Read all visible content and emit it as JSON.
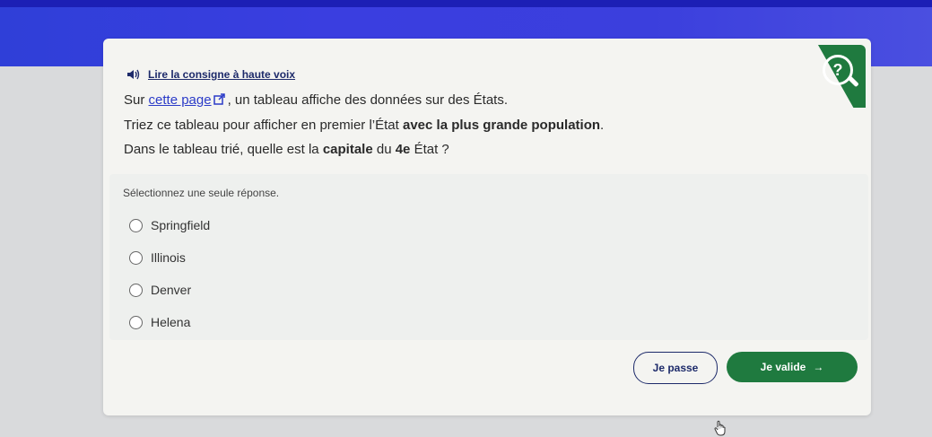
{
  "audio": {
    "label": "Lire la consigne à haute voix",
    "icon": "speaker-icon"
  },
  "question": {
    "line1": {
      "before": "Sur ",
      "link": "cette page",
      "after": ", un tableau affiche des données sur des États."
    },
    "line2": {
      "before": "Triez ce tableau pour afficher en premier l’État ",
      "bold": "avec la plus grande population",
      "after": "."
    },
    "line3": {
      "before": "Dans le tableau trié, quelle est la ",
      "bold1": "capitale",
      "mid": " du ",
      "bold2": "4e",
      "after": " État ?"
    }
  },
  "help_badge": {
    "symbol": "?",
    "color": "#1f7a3f"
  },
  "answers": {
    "instruction": "Sélectionnez une seule réponse.",
    "options": [
      "Springfield",
      "Illinois",
      "Denver",
      "Helena"
    ]
  },
  "buttons": {
    "skip": "Je passe",
    "validate": "Je valide",
    "validate_arrow": "→"
  },
  "colors": {
    "accent_blue": "#2f3fd8",
    "accent_green": "#1f7a3f",
    "link": "#2b3bc8"
  }
}
